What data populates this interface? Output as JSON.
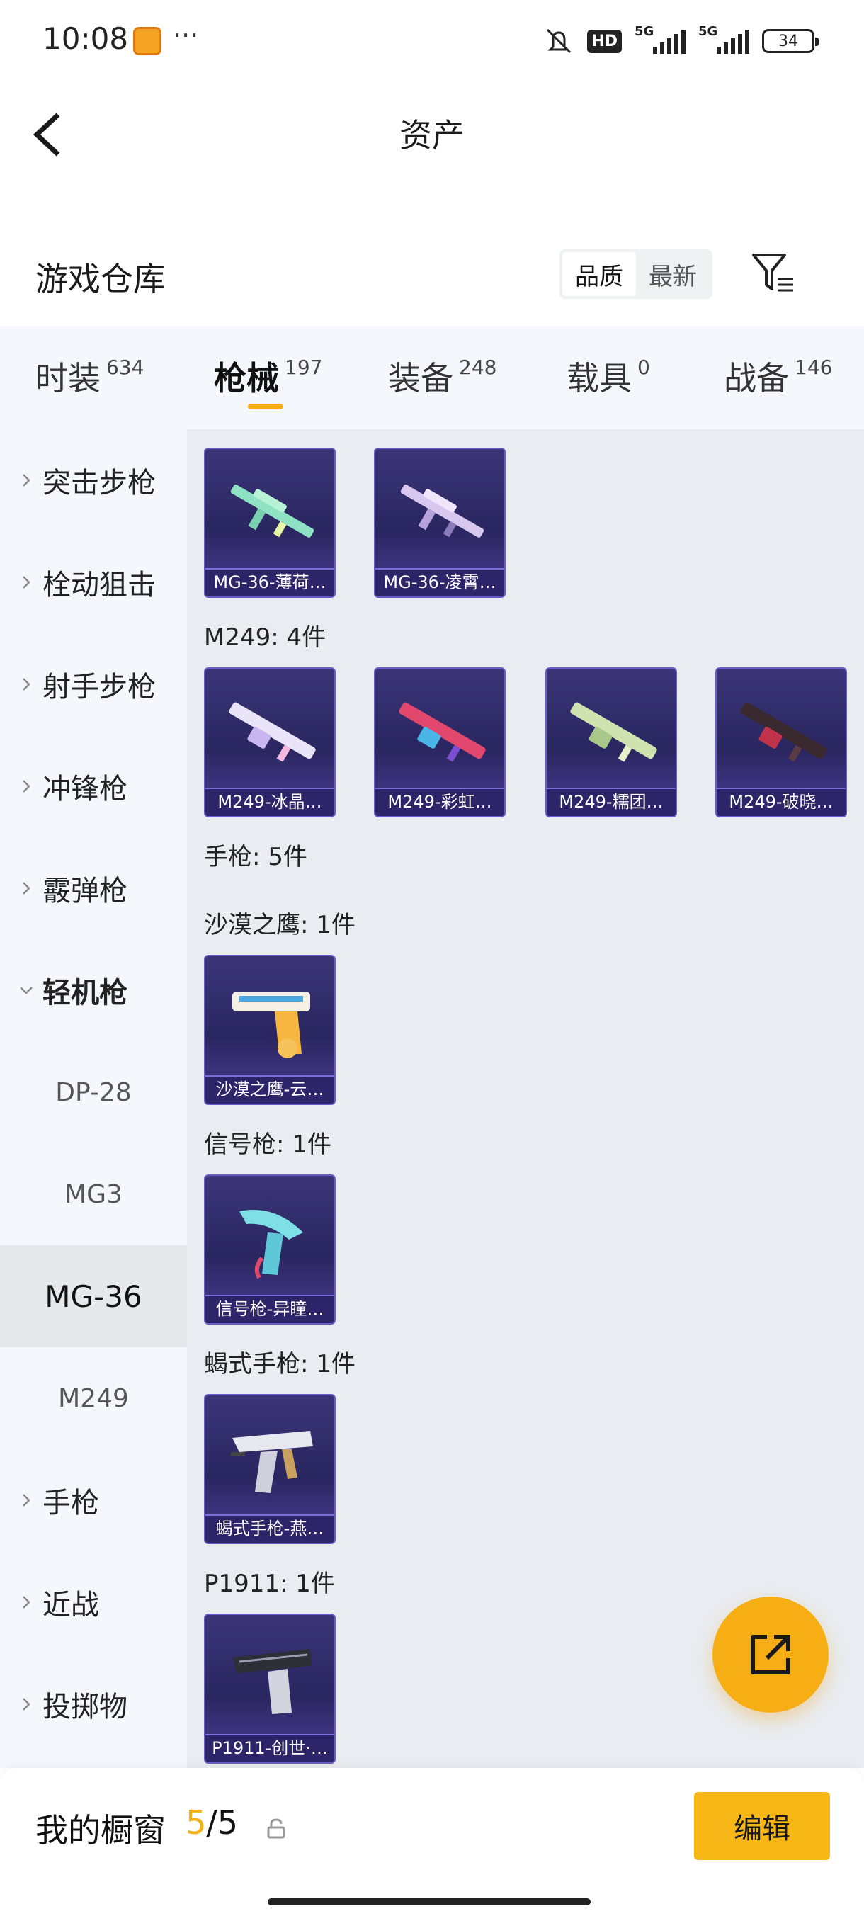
{
  "status_bar": {
    "time": "10:08",
    "more": "···",
    "hd": "HD",
    "net1": "5G",
    "net2": "5G",
    "battery": "34",
    "icons": [
      "mascot-icon",
      "silent-icon",
      "signal-icon",
      "battery-icon"
    ]
  },
  "header": {
    "title": "资产",
    "back_icon": "back-icon"
  },
  "warehouse": {
    "title": "游戏仓库",
    "sort_options": [
      "品质",
      "最新"
    ],
    "active_sort": "品质",
    "filter_icon": "filter-icon"
  },
  "tabs": [
    {
      "label": "时装",
      "count": "634"
    },
    {
      "label": "枪械",
      "count": "197",
      "active": true
    },
    {
      "label": "装备",
      "count": "248"
    },
    {
      "label": "载具",
      "count": "0"
    },
    {
      "label": "战备",
      "count": "146"
    }
  ],
  "sidebar": {
    "categories": [
      {
        "label": "突击步枪"
      },
      {
        "label": "栓动狙击"
      },
      {
        "label": "射手步枪"
      },
      {
        "label": "冲锋枪"
      },
      {
        "label": "霰弹枪"
      },
      {
        "label": "轻机枪",
        "expanded": true
      },
      {
        "label": "手枪"
      },
      {
        "label": "近战"
      },
      {
        "label": "投掷物"
      }
    ],
    "sub_items": [
      {
        "label": "DP-28"
      },
      {
        "label": "MG3"
      },
      {
        "label": "MG-36",
        "selected": true
      },
      {
        "label": "M249"
      }
    ]
  },
  "content": {
    "top_cards": [
      {
        "name": "MG-36-薄荷…"
      },
      {
        "name": "MG-36-凌霄…"
      }
    ],
    "m249_label": "M249: 4件",
    "m249_cards": [
      {
        "name": "M249-冰晶…"
      },
      {
        "name": "M249-彩虹…"
      },
      {
        "name": "M249-糯团…"
      },
      {
        "name": "M249-破晓…"
      }
    ],
    "pistol_label": "手枪: 5件",
    "deagle_label": "沙漠之鹰: 1件",
    "deagle_cards": [
      {
        "name": "沙漠之鹰-云…"
      }
    ],
    "flare_label": "信号枪: 1件",
    "flare_cards": [
      {
        "name": "信号枪-异瞳…"
      }
    ],
    "scorpion_label": "蝎式手枪: 1件",
    "scorpion_cards": [
      {
        "name": "蝎式手枪-燕…"
      }
    ],
    "p1911_label": "P1911: 1件",
    "p1911_cards": [
      {
        "name": "P1911-创世·…"
      }
    ]
  },
  "fab_icon": "share-icon",
  "bottom_bar": {
    "label": "我的橱窗",
    "used": "5",
    "slash": "/",
    "total": "5",
    "lock_icon": "lock-icon",
    "edit_label": "编辑"
  },
  "colors": {
    "accent": "#f5b014",
    "card_bg": "#2a2660",
    "content_bg": "#e9ecf0",
    "sidebar_bg": "#f4f7fb"
  }
}
